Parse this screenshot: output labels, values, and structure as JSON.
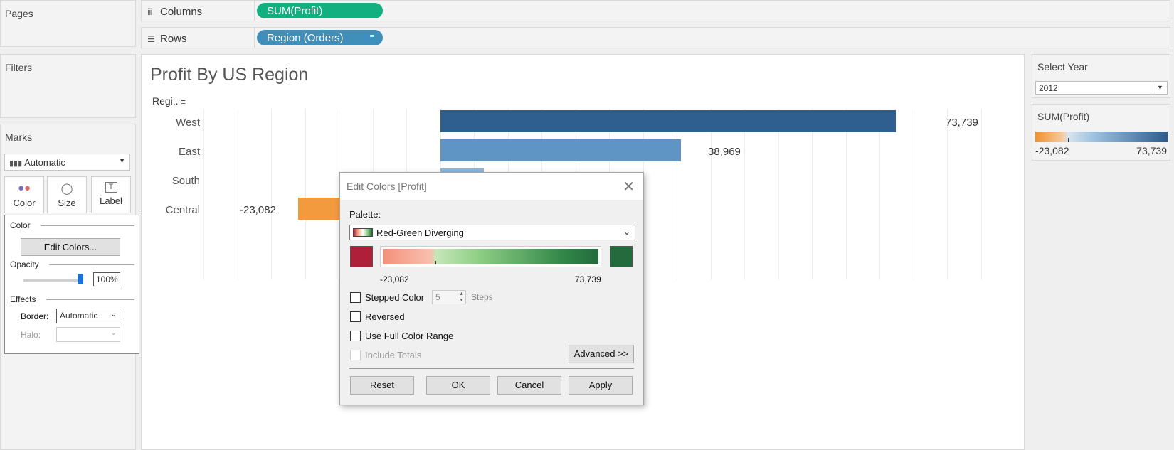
{
  "sidebar": {
    "pages_title": "Pages",
    "filters_title": "Filters",
    "marks_title": "Marks",
    "mark_type": "Automatic",
    "mark_buttons": [
      "Color",
      "Size",
      "Label"
    ],
    "color_popup": {
      "color_section": "Color",
      "edit_colors_label": "Edit Colors...",
      "opacity_section": "Opacity",
      "opacity_value": "100%",
      "effects_section": "Effects",
      "border_label": "Border:",
      "border_value": "Automatic",
      "halo_label": "Halo:"
    }
  },
  "shelves": {
    "columns_label": "Columns",
    "columns_pill": "SUM(Profit)",
    "rows_label": "Rows",
    "rows_pill": "Region (Orders)"
  },
  "viz": {
    "title": "Profit By US Region",
    "row_header": "Regi..",
    "rows": [
      {
        "label": "West",
        "value_text": "73,739"
      },
      {
        "label": "East",
        "value_text": "38,969"
      },
      {
        "label": "South",
        "value_text": ""
      },
      {
        "label": "Central",
        "value_text": "-23,082"
      }
    ]
  },
  "chart_data": {
    "type": "bar",
    "categories": [
      "West",
      "East",
      "South",
      "Central"
    ],
    "values": [
      73739,
      38969,
      7000,
      -23082
    ],
    "title": "Profit By US Region",
    "colors": [
      "#2e5f8e",
      "#5e95c4",
      "#8db7db",
      "#f39a3e"
    ]
  },
  "right_panel": {
    "select_year_title": "Select Year",
    "select_year_value": "2012",
    "legend_title": "SUM(Profit)",
    "legend_min": "-23,082",
    "legend_max": "73,739"
  },
  "dialog": {
    "title": "Edit Colors [Profit]",
    "palette_label": "Palette:",
    "palette_value": "Red-Green Diverging",
    "range_min": "-23,082",
    "range_max": "73,739",
    "stepped_color_label": "Stepped Color",
    "steps_value": "5",
    "steps_label": "Steps",
    "reversed_label": "Reversed",
    "full_range_label": "Use Full Color Range",
    "include_totals_label": "Include Totals",
    "advanced_label": "Advanced >>",
    "reset_label": "Reset",
    "ok_label": "OK",
    "cancel_label": "Cancel",
    "apply_label": "Apply"
  }
}
